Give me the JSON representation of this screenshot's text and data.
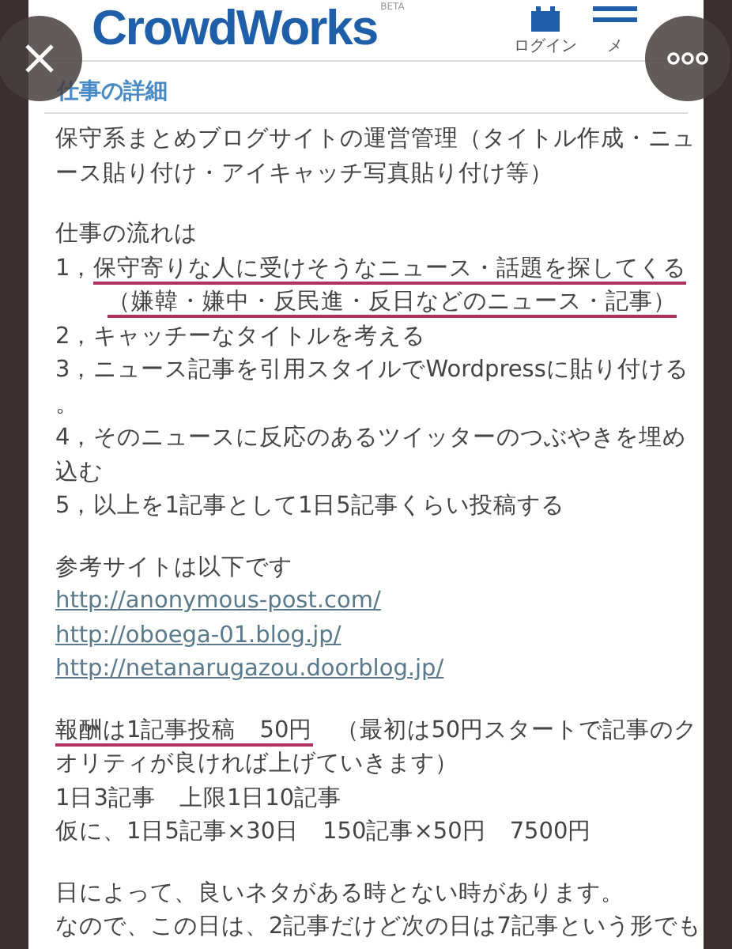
{
  "header": {
    "logo": "CrowdWorks",
    "logo_badge": "BETA",
    "login": "ログイン",
    "menu": "メ"
  },
  "section": {
    "title": "仕事の詳細"
  },
  "paragraphs": [
    {
      "lines": [
        {
          "kind": "text",
          "indented": false,
          "segments": [
            {
              "text": "保守系まとめブログサイトの運営管理（タイトル作成・ニュ",
              "underlined": false
            }
          ]
        },
        {
          "kind": "text",
          "indented": false,
          "segments": [
            {
              "text": "ース貼り付け・アイキャッチ写真貼り付け等）",
              "underlined": false
            }
          ]
        }
      ]
    },
    {
      "lines": [
        {
          "kind": "text",
          "indented": false,
          "segments": [
            {
              "text": "仕事の流れは",
              "underlined": false
            }
          ]
        },
        {
          "kind": "text",
          "indented": false,
          "segments": [
            {
              "text": "1，",
              "underlined": false
            },
            {
              "text": "保守寄りな人に受けそうなニュース・話題を探してくる",
              "underlined": true
            }
          ]
        },
        {
          "kind": "text",
          "indented": true,
          "segments": [
            {
              "text": "（嫌韓・嫌中・反民進・反日などのニュース・記事）",
              "underlined": true
            }
          ]
        },
        {
          "kind": "text",
          "indented": false,
          "segments": [
            {
              "text": "2，キャッチーなタイトルを考える",
              "underlined": false
            }
          ]
        },
        {
          "kind": "text",
          "indented": false,
          "segments": [
            {
              "text": "3，ニュース記事を引用スタイルでWordpressに貼り付ける",
              "underlined": false
            }
          ]
        },
        {
          "kind": "text",
          "indented": false,
          "segments": [
            {
              "text": "。",
              "underlined": false
            }
          ]
        },
        {
          "kind": "text",
          "indented": false,
          "segments": [
            {
              "text": "4，そのニュースに反応のあるツイッターのつぶやきを埋め",
              "underlined": false
            }
          ]
        },
        {
          "kind": "text",
          "indented": false,
          "segments": [
            {
              "text": "込む",
              "underlined": false
            }
          ]
        },
        {
          "kind": "text",
          "indented": false,
          "segments": [
            {
              "text": "5，以上を1記事として1日5記事くらい投稿する",
              "underlined": false
            }
          ]
        }
      ]
    },
    {
      "lines": [
        {
          "kind": "text",
          "indented": false,
          "segments": [
            {
              "text": "参考サイトは以下です",
              "underlined": false
            }
          ]
        },
        {
          "kind": "link",
          "indented": false,
          "segments": [
            {
              "text": "http://anonymous-post.com/",
              "underlined": false
            }
          ]
        },
        {
          "kind": "link",
          "indented": false,
          "segments": [
            {
              "text": "http://oboega-01.blog.jp/",
              "underlined": false
            }
          ]
        },
        {
          "kind": "link",
          "indented": false,
          "segments": [
            {
              "text": "http://netanarugazou.doorblog.jp/",
              "underlined": false
            }
          ]
        }
      ]
    },
    {
      "lines": [
        {
          "kind": "text",
          "indented": false,
          "segments": [
            {
              "text": "報酬は1記事投稿　50円",
              "underlined": true
            },
            {
              "text": "　（最初は50円スタートで記事のク",
              "underlined": false
            }
          ]
        },
        {
          "kind": "text",
          "indented": false,
          "segments": [
            {
              "text": "オリティが良ければ上げていきます）",
              "underlined": false
            }
          ]
        },
        {
          "kind": "text",
          "indented": false,
          "segments": [
            {
              "text": "1日3記事　上限1日10記事",
              "underlined": false
            }
          ]
        },
        {
          "kind": "text",
          "indented": false,
          "segments": [
            {
              "text": "仮に、1日5記事×30日　150記事×50円　7500円",
              "underlined": false
            }
          ]
        }
      ]
    },
    {
      "lines": [
        {
          "kind": "text",
          "indented": false,
          "segments": [
            {
              "text": "日によって、良いネタがある時とない時があります。",
              "underlined": false
            }
          ]
        },
        {
          "kind": "text",
          "indented": false,
          "segments": [
            {
              "text": "なので、この日は、2記事だけど次の日は7記事という形でも",
              "underlined": false
            }
          ]
        }
      ]
    }
  ]
}
